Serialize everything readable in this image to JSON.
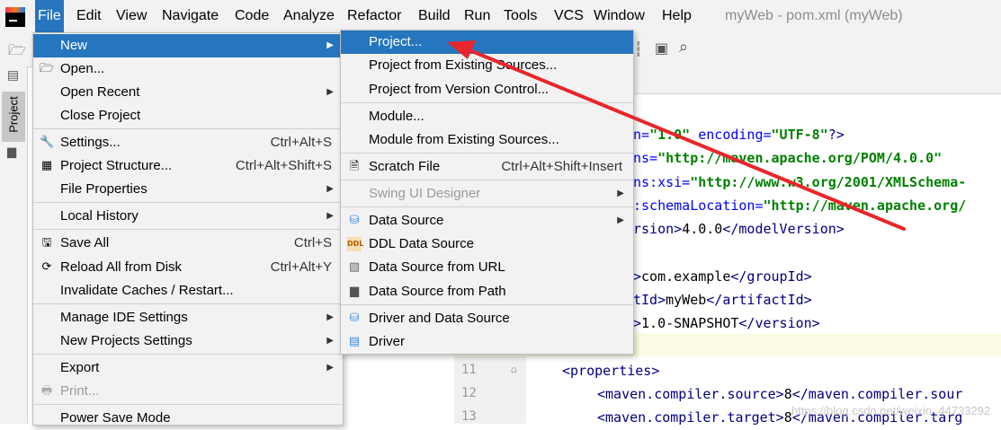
{
  "menubar": {
    "items": [
      "File",
      "Edit",
      "View",
      "Navigate",
      "Code",
      "Analyze",
      "Refactor",
      "Build",
      "Run",
      "Tools",
      "VCS",
      "Window",
      "Help"
    ],
    "window_title": "myWeb - pom.xml (myWeb)"
  },
  "left_strip": {
    "project_tab": "Project"
  },
  "file_menu": {
    "items": [
      {
        "label": "New",
        "shortcut": ""
      },
      {
        "label": "Open...",
        "shortcut": ""
      },
      {
        "label": "Open Recent",
        "shortcut": ""
      },
      {
        "label": "Close Project",
        "shortcut": ""
      },
      {
        "label": "Settings...",
        "shortcut": "Ctrl+Alt+S"
      },
      {
        "label": "Project Structure...",
        "shortcut": "Ctrl+Alt+Shift+S"
      },
      {
        "label": "File Properties",
        "shortcut": ""
      },
      {
        "label": "Local History",
        "shortcut": ""
      },
      {
        "label": "Save All",
        "shortcut": "Ctrl+S"
      },
      {
        "label": "Reload All from Disk",
        "shortcut": "Ctrl+Alt+Y"
      },
      {
        "label": "Invalidate Caches / Restart...",
        "shortcut": ""
      },
      {
        "label": "Manage IDE Settings",
        "shortcut": ""
      },
      {
        "label": "New Projects Settings",
        "shortcut": ""
      },
      {
        "label": "Export",
        "shortcut": ""
      },
      {
        "label": "Print...",
        "shortcut": ""
      },
      {
        "label": "Power Save Mode",
        "shortcut": ""
      }
    ]
  },
  "new_menu": {
    "items": [
      {
        "label": "Project...",
        "shortcut": ""
      },
      {
        "label": "Project from Existing Sources...",
        "shortcut": ""
      },
      {
        "label": "Project from Version Control...",
        "shortcut": ""
      },
      {
        "label": "Module...",
        "shortcut": ""
      },
      {
        "label": "Module from Existing Sources...",
        "shortcut": ""
      },
      {
        "label": "Scratch File",
        "shortcut": "Ctrl+Alt+Shift+Insert"
      },
      {
        "label": "Swing UI Designer",
        "shortcut": ""
      },
      {
        "label": "Data Source",
        "shortcut": ""
      },
      {
        "label": "DDL Data Source",
        "shortcut": ""
      },
      {
        "label": "Data Source from URL",
        "shortcut": ""
      },
      {
        "label": "Data Source from Path",
        "shortcut": ""
      },
      {
        "label": "Driver and Data Source",
        "shortcut": ""
      },
      {
        "label": "Driver",
        "shortcut": ""
      }
    ]
  },
  "editor": {
    "lines": [
      {
        "p1": "n=",
        "p2": "\"1.0\"",
        "p3": " encoding=",
        "p4": "\"UTF-8\"",
        "p5": "?>"
      },
      {
        "p1": "ns=",
        "p2": "\"http://maven.apache.org/POM/4.0.0\"",
        "p3": "",
        "p4": "",
        "p5": ""
      },
      {
        "p1": "ns:xsi=",
        "p2": "\"http://www.w3.org/2001/XMLSchema-",
        "p3": "",
        "p4": "",
        "p5": ""
      },
      {
        "p1": ":schemaLocation=",
        "p2": "\"http://maven.apache.org/",
        "p3": "",
        "p4": "",
        "p5": ""
      },
      {
        "p1": "rsion>",
        "p2": "4.0.0",
        "p3": "</modelVersion>",
        "p4": "",
        "p5": ""
      },
      {
        "p1": ">",
        "p2": "com.example",
        "p3": "</groupId>",
        "p4": "",
        "p5": ""
      },
      {
        "p1": "tId>",
        "p2": "myWeb",
        "p3": "</artifactId>",
        "p4": "",
        "p5": ""
      },
      {
        "p1": ">",
        "p2": "1.0-SNAPSHOT",
        "p3": "</version>",
        "p4": "",
        "p5": ""
      },
      {
        "p1": "<properties>",
        "p2": "",
        "p3": "",
        "p4": "",
        "p5": ""
      },
      {
        "p1": "<maven.compiler.source>",
        "p2": "8",
        "p3": "</maven.compiler.sour",
        "p4": "",
        "p5": ""
      },
      {
        "p1": "<maven.compiler.target>",
        "p2": "8",
        "p3": "</maven.compiler.targ",
        "p4": "",
        "p5": ""
      }
    ],
    "line_numbers": [
      "11",
      "12",
      "13"
    ],
    "watermark": "https://blog.csdn.net/weixin_44733292"
  },
  "colors": {
    "accent": "#2675bf",
    "arrow": "#e8262b"
  }
}
